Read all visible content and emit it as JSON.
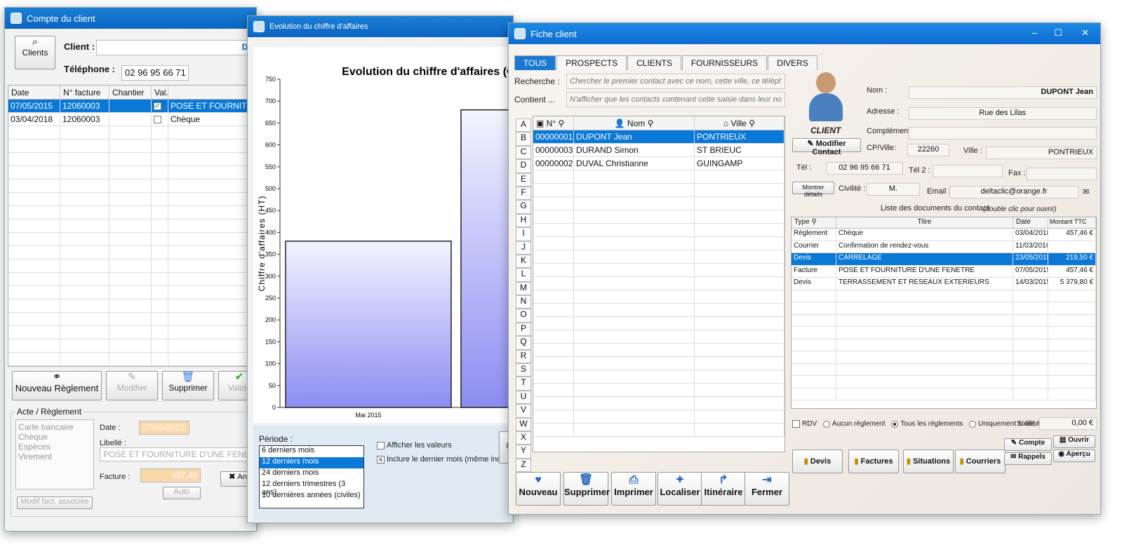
{
  "w1": {
    "title": "Compte du client",
    "clients_btn": "Clients",
    "client_label": "Client :",
    "client_value": "DU",
    "tel_label": "Téléphone :",
    "tel_value": "02 96 95 66 71",
    "columns": [
      "Date",
      "N° facture",
      "Chantier",
      "Val.",
      ""
    ],
    "rows": [
      {
        "date": "07/05/2015",
        "num": "12060003",
        "chantier": "",
        "val": "checked",
        "label": "POSE ET FOURNITURE"
      },
      {
        "date": "03/04/2018",
        "num": "12060003",
        "chantier": "",
        "val": "unchecked",
        "label": "Chèque"
      }
    ],
    "buttons": {
      "new": "Nouveau Règlement",
      "edit": "Modifier",
      "delete": "Supprimer",
      "validate": "Valide"
    },
    "acte": {
      "title": "Acte / Règlement",
      "modes": [
        "Carte bancaire",
        "Chèque",
        "Espèces",
        "Virement"
      ],
      "date_label": "Date :",
      "date_value": "07/05/2015",
      "libelle_label": "Libellé :",
      "libelle_value": "POSE ET FOURNITURE D'UNE FENETRE",
      "facture_label": "Facture :",
      "facture_value": "457,46",
      "auto": "Auto",
      "close": "An",
      "modif": "Modif fact. associée"
    }
  },
  "w2": {
    "title": "Evolution du chiffre d'affaires",
    "chart_title": "Evolution du chiffre d'affaires (€",
    "periode_label": "Période :",
    "periods": [
      "6 derniers mois",
      "12 derniers mois",
      "24 derniers mois",
      "12 derniers trimestres (3 ans)",
      "10 dernières années (civiles)"
    ],
    "selected_period": 1,
    "afficher": "Afficher les valeurs",
    "inclure": "Inclure le dernier mois (même incomplet)",
    "inclure_check": "x",
    "extra_btn": "In"
  },
  "chart_data": {
    "type": "bar",
    "title": "Evolution du chiffre d'affaires (€",
    "ylabel": "Chiffre d'affaires (HT)",
    "ylim": [
      0,
      750
    ],
    "yticks": [
      0,
      50,
      100,
      150,
      200,
      250,
      300,
      350,
      400,
      450,
      500,
      550,
      600,
      650,
      700,
      750
    ],
    "categories": [
      "Mai 2015",
      ""
    ],
    "values": [
      380,
      680
    ]
  },
  "w3": {
    "title": "Fiche client",
    "tabs": [
      "TOUS",
      "PROSPECTS",
      "CLIENTS",
      "FOURNISSEURS",
      "DIVERS"
    ],
    "recherche_label": "Recherche :",
    "recherche_placeholder": "Chercher le premier contact avec ce nom, cette ville, ce téléphone,",
    "contient_label": "Contient ...",
    "contient_placeholder": "N'afficher que les contacts contenant cette saisie dans leur nom, ad",
    "letters": [
      "A",
      "B",
      "C",
      "D",
      "E",
      "F",
      "G",
      "H",
      "I",
      "J",
      "K",
      "L",
      "M",
      "N",
      "O",
      "P",
      "Q",
      "R",
      "S",
      "T",
      "U",
      "V",
      "W",
      "X",
      "Y",
      "Z"
    ],
    "cols": [
      "N°",
      "Nom",
      "Ville"
    ],
    "contacts": [
      {
        "num": "00000001",
        "nom": "DUPONT Jean",
        "ville": "PONTRIEUX"
      },
      {
        "num": "00000003",
        "nom": "DURAND Simon",
        "ville": "ST BRIEUC"
      },
      {
        "num": "00000002",
        "nom": "DUVAL Christianne",
        "ville": "GUINGAMP"
      }
    ],
    "bottom": [
      "Nouveau",
      "Supprimer",
      "Imprimer",
      "Localiser",
      "Itinéraire",
      "Fermer"
    ],
    "client_caption": "CLIENT",
    "modif_contact": "Modifier Contact",
    "montrer": "Montrer détails",
    "nom_label": "Nom :",
    "nom_value": "DUPONT Jean",
    "adresse_label": "Adresse :",
    "adresse_value": "Rue des Lilas",
    "complement_label": "Complément :",
    "cp_label": "CP/Ville:",
    "cp_value": "22260",
    "ville_label": "Ville :",
    "ville_value": "PONTRIEUX",
    "tel_label": "Tél :",
    "tel_value": "02 96 95 66 71",
    "tel2_label": "Tél 2 :",
    "fax_label": "Fax :",
    "civ_label": "Civilité :",
    "civ_value": "M.",
    "email_label": "Email :",
    "email_value": "deltaclic@orange.fr",
    "docs_title": "Liste des documents du contact",
    "docs_hint": "(double clic pour ouvrir)",
    "doc_cols": [
      "Type",
      "Titre",
      "Date",
      "Montant TTC"
    ],
    "docs": [
      {
        "type": "Règlement",
        "titre": "Chèque",
        "date": "03/04/2018",
        "montant": "457,46 €"
      },
      {
        "type": "Courrier",
        "titre": "Confirmation de rendez-vous",
        "date": "11/03/2016",
        "montant": ""
      },
      {
        "type": "Devis",
        "titre": "CARRELAGE",
        "date": "23/05/2015",
        "montant": "219,50 €"
      },
      {
        "type": "Facture",
        "titre": "POSE ET FOURNITURE D'UNE FENETRE",
        "date": "07/05/2015",
        "montant": "457,46 €"
      },
      {
        "type": "Devis",
        "titre": "TERRASSEMENT ET RESEAUX EXTERIEURS",
        "date": "14/03/2015",
        "montant": "5 379,80 €"
      }
    ],
    "rdv": "RDV",
    "opt1": "Aucun règlement",
    "opt2": "Tous les règlements",
    "opt3": "Uniquement si débiteur",
    "solde_label": "Solde :",
    "solde_value": "0,00 €",
    "right_btns": [
      "Devis",
      "Factures",
      "Situations",
      "Courriers"
    ],
    "compte": "Compte",
    "rappels": "Rappels",
    "ouvrir": "Ouvrir",
    "apercu": "Aperçu"
  }
}
